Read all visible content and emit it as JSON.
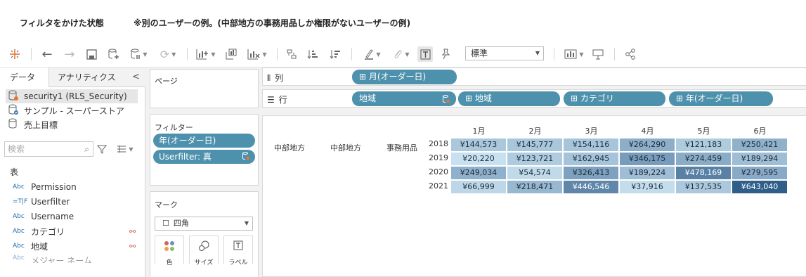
{
  "captions": {
    "left": "フィルタをかけた状態",
    "right": "※別のユーザーの例。(中部地方の事務用品しか権限がないユーザーの例)"
  },
  "toolbar": {
    "font_select": "標準",
    "icons": [
      "tableau-logo-icon",
      "back-icon",
      "forward-icon",
      "save-icon",
      "new-datasource-icon",
      "pause-updates-icon",
      "refresh-icon",
      "new-worksheet-icon",
      "duplicate-icon",
      "clear-sheet-icon",
      "swap-icon",
      "sort-asc-icon",
      "sort-desc-icon",
      "highlight-icon",
      "group-icon",
      "text-label-icon",
      "pin-icon",
      "show-cards-icon",
      "presentation-icon",
      "share-icon"
    ]
  },
  "data_pane": {
    "tabs": [
      "データ",
      "アナリティクス"
    ],
    "collapse_label": "<",
    "datasources": [
      "security1 (RLS_Security)",
      "サンプル - スーパーストア",
      "売上目標"
    ],
    "search_placeholder": "検索",
    "section_label": "表",
    "fields": [
      {
        "type": "Abc",
        "name": "Permission",
        "linked": false
      },
      {
        "type": "=T|F",
        "name": "Userfilter",
        "linked": false
      },
      {
        "type": "Abc",
        "name": "Username",
        "linked": false
      },
      {
        "type": "Abc",
        "name": "カテゴリ",
        "linked": true
      },
      {
        "type": "Abc",
        "name": "地域",
        "linked": true
      },
      {
        "type": "Abc",
        "name": "メジャー ネーム",
        "linked": false
      }
    ]
  },
  "shelves": {
    "pages_label": "ページ",
    "filters_label": "フィルター",
    "filters": [
      "年(オーダー日)",
      "Userfilter: 真"
    ],
    "marks_label": "マーク",
    "mark_type": "四角",
    "mark_buttons": [
      "色",
      "サイズ",
      "ラベル"
    ],
    "columns_label": "列",
    "rows_label": "行",
    "column_pills": [
      "月(オーダー日)"
    ],
    "row_pills": [
      "地域",
      "地域",
      "カテゴリ",
      "年(オーダー日)"
    ]
  },
  "table": {
    "row_headers": [
      "中部地方",
      "中部地方",
      "事務用品"
    ],
    "months": [
      "1月",
      "2月",
      "3月",
      "4月",
      "5月",
      "6月"
    ],
    "years": [
      "2018",
      "2019",
      "2020",
      "2021"
    ],
    "values": [
      [
        "¥144,573",
        "¥145,777",
        "¥154,116",
        "¥264,290",
        "¥121,183",
        "¥250,421"
      ],
      [
        "¥20,220",
        "¥123,721",
        "¥162,945",
        "¥346,175",
        "¥274,459",
        "¥189,294"
      ],
      [
        "¥249,034",
        "¥54,574",
        "¥326,413",
        "¥189,224",
        "¥478,169",
        "¥279,595"
      ],
      [
        "¥66,999",
        "¥218,471",
        "¥446,546",
        "¥37,916",
        "¥137,535",
        "¥643,040"
      ]
    ]
  }
}
